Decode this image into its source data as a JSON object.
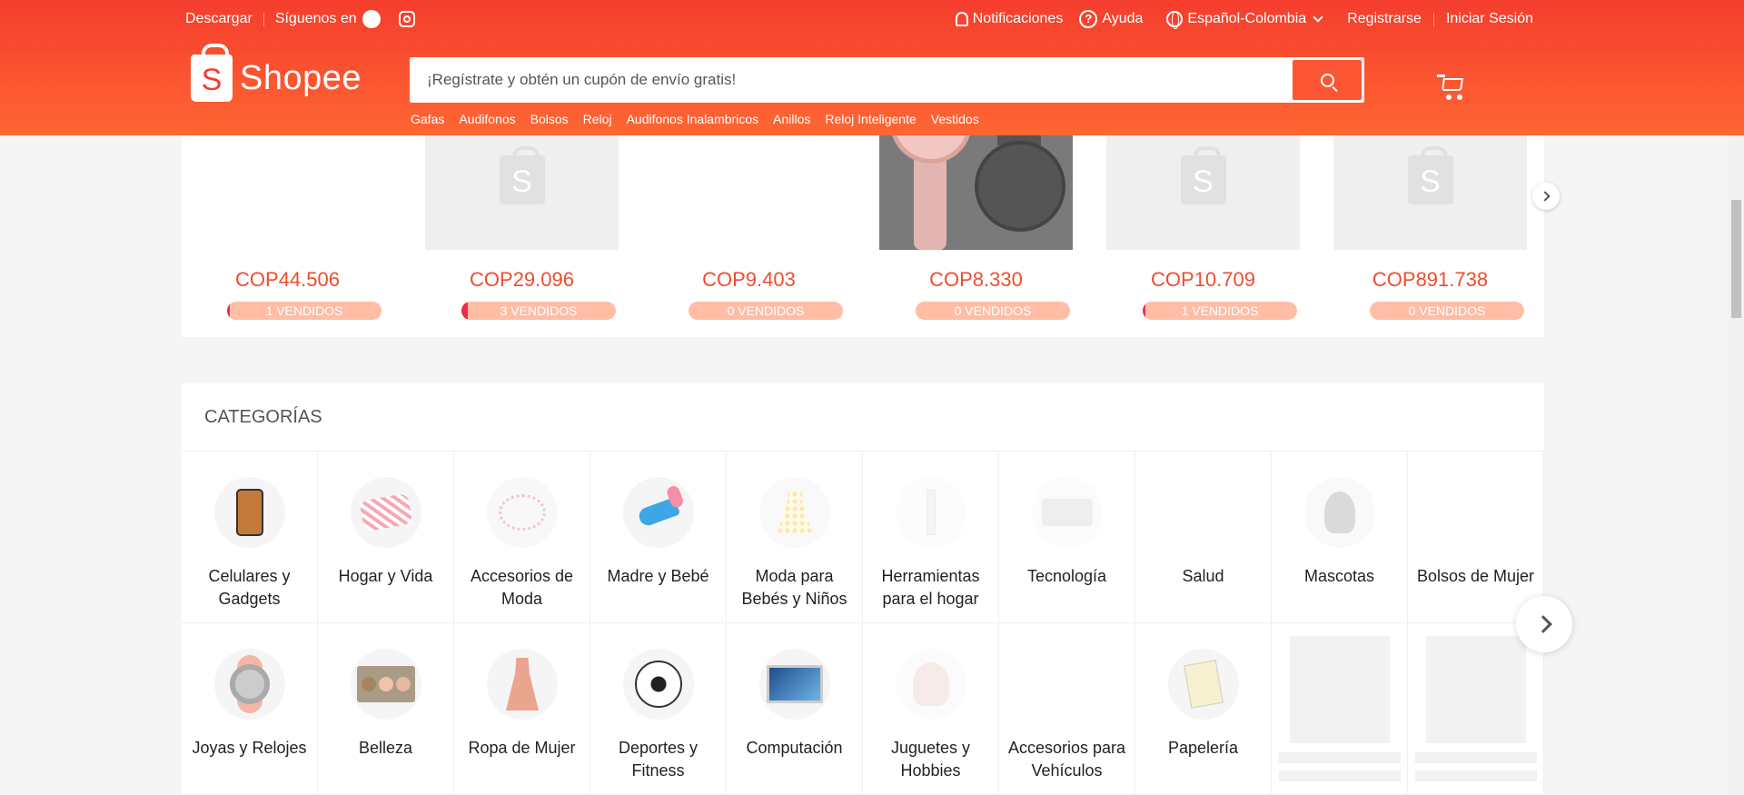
{
  "topbar": {
    "download": "Descargar",
    "follow": "Síguenos en",
    "notifications": "Notificaciones",
    "help": "Ayuda",
    "language": "Español-Colombia",
    "register": "Registrarse",
    "login": "Iniciar Sesión"
  },
  "header": {
    "logo_text": "Shopee",
    "search_placeholder": "¡Regístrate y obtén un cupón de envío gratis!",
    "keywords": [
      "Gafas",
      "Audifonos",
      "Bolsos",
      "Reloj",
      "Audifonos Inalambricos",
      "Anillos",
      "Reloj Inteligente",
      "Vestidos"
    ]
  },
  "flash_sale": {
    "items": [
      {
        "price": "COP44.506",
        "sold": "1 VENDIDOS",
        "sold_fraction": 0.02,
        "image": "blank"
      },
      {
        "price": "COP29.096",
        "sold": "3 VENDIDOS",
        "sold_fraction": 0.04,
        "image": "placeholder"
      },
      {
        "price": "COP9.403",
        "sold": "0 VENDIDOS",
        "sold_fraction": 0,
        "image": "blank"
      },
      {
        "price": "COP8.330",
        "sold": "0 VENDIDOS",
        "sold_fraction": 0,
        "image": "watch"
      },
      {
        "price": "COP10.709",
        "sold": "1 VENDIDOS",
        "sold_fraction": 0.02,
        "image": "placeholder"
      },
      {
        "price": "COP891.738",
        "sold": "0 VENDIDOS",
        "sold_fraction": 0,
        "image": "placeholder"
      }
    ]
  },
  "categories": {
    "title": "CATEGORÍAS",
    "row1": [
      {
        "label": "Celulares y Gadgets",
        "icon": "phone-icon"
      },
      {
        "label": "Hogar y Vida",
        "icon": "pillow-icon"
      },
      {
        "label": "Accesorios de Moda",
        "icon": "bracelet-icon"
      },
      {
        "label": "Madre y Bebé",
        "icon": "baby-bottle-icon"
      },
      {
        "label": "Moda para Bebés y Niños",
        "icon": "baby-dress-icon"
      },
      {
        "label": "Herramientas para el hogar",
        "icon": "tools-icon"
      },
      {
        "label": "Tecnología",
        "icon": "speaker-icon"
      },
      {
        "label": "Salud",
        "icon": "health-icon"
      },
      {
        "label": "Mascotas",
        "icon": "cat-icon"
      },
      {
        "label": "Bolsos de Mujer",
        "icon": "handbag-icon"
      }
    ],
    "row2": [
      {
        "label": "Joyas y Relojes",
        "icon": "watch-icon"
      },
      {
        "label": "Belleza",
        "icon": "palette-icon"
      },
      {
        "label": "Ropa de Mujer",
        "icon": "dress-icon"
      },
      {
        "label": "Deportes y Fitness",
        "icon": "soccer-ball-icon"
      },
      {
        "label": "Computación",
        "icon": "monitor-icon"
      },
      {
        "label": "Juguetes y Hobbies",
        "icon": "doll-icon"
      },
      {
        "label": "Accesorios para Vehículos",
        "icon": "car-icon"
      },
      {
        "label": "Papelería",
        "icon": "stationery-icon"
      }
    ]
  },
  "colors": {
    "brand": "#ee4d2d",
    "header_top": "#f53d2d",
    "header_bottom": "#ff6633"
  }
}
